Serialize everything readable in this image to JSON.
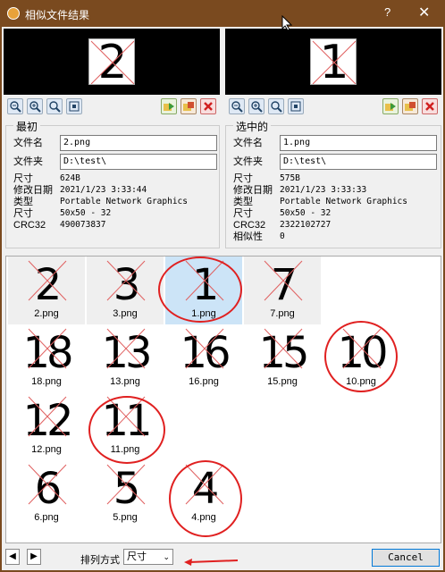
{
  "window": {
    "title": "相似文件结果",
    "help_label": "?",
    "close_label": "✕"
  },
  "left": {
    "preview_glyph": "2",
    "group_title": "最初",
    "labels": {
      "name": "文件名",
      "folder": "文件夹",
      "size": "尺寸",
      "modified": "修改日期",
      "type": "类型",
      "dims": "尺寸",
      "crc": "CRC32"
    },
    "name": "2.png",
    "folder": "D:\\test\\",
    "size": "624B",
    "modified": "2021/1/23 3:33:44",
    "type": "Portable Network Graphics",
    "dims": "50x50 - 32",
    "crc": "490073837"
  },
  "right": {
    "preview_glyph": "1",
    "group_title": "选中的",
    "labels": {
      "name": "文件名",
      "folder": "文件夹",
      "size": "尺寸",
      "modified": "修改日期",
      "type": "类型",
      "dims": "尺寸",
      "crc": "CRC32",
      "similarity": "相似性"
    },
    "name": "1.png",
    "folder": "D:\\test\\",
    "size": "575B",
    "modified": "2021/1/23 3:33:33",
    "type": "Portable Network Graphics",
    "dims": "50x50 - 32",
    "crc": "2322102727",
    "similarity": "0"
  },
  "results": [
    {
      "glyph": "2",
      "name": "2.png",
      "state": "shaded"
    },
    {
      "glyph": "3",
      "name": "3.png",
      "state": "shaded"
    },
    {
      "glyph": "1",
      "name": "1.png",
      "state": "selected"
    },
    {
      "glyph": "7",
      "name": "7.png",
      "state": "shaded"
    },
    {
      "glyph": "18",
      "name": "18.png",
      "state": "normal"
    },
    {
      "glyph": "13",
      "name": "13.png",
      "state": "normal"
    },
    {
      "glyph": "16",
      "name": "16.png",
      "state": "normal"
    },
    {
      "glyph": "15",
      "name": "15.png",
      "state": "normal"
    },
    {
      "glyph": "10",
      "name": "10.png",
      "state": "normal"
    },
    {
      "glyph": "12",
      "name": "12.png",
      "state": "normal"
    },
    {
      "glyph": "11",
      "name": "11.png",
      "state": "normal"
    },
    {
      "glyph": "6",
      "name": "6.png",
      "state": "normal"
    },
    {
      "glyph": "5",
      "name": "5.png",
      "state": "normal"
    },
    {
      "glyph": "4",
      "name": "4.png",
      "state": "normal"
    }
  ],
  "footer": {
    "prev": "◀",
    "next": "▶",
    "sort_label": "排列方式",
    "sort_value": "尺寸",
    "cancel": "Cancel"
  },
  "colors": {
    "title_bar": "#7a4a1f",
    "selection": "#cce4f7",
    "annotation_red": "#e02020",
    "cross_red": "#e06060"
  },
  "icons": [
    "zoom-out-icon",
    "zoom-in-icon",
    "actual-size-icon",
    "fit-window-icon",
    "move-icon",
    "copy-icon",
    "delete-icon"
  ]
}
